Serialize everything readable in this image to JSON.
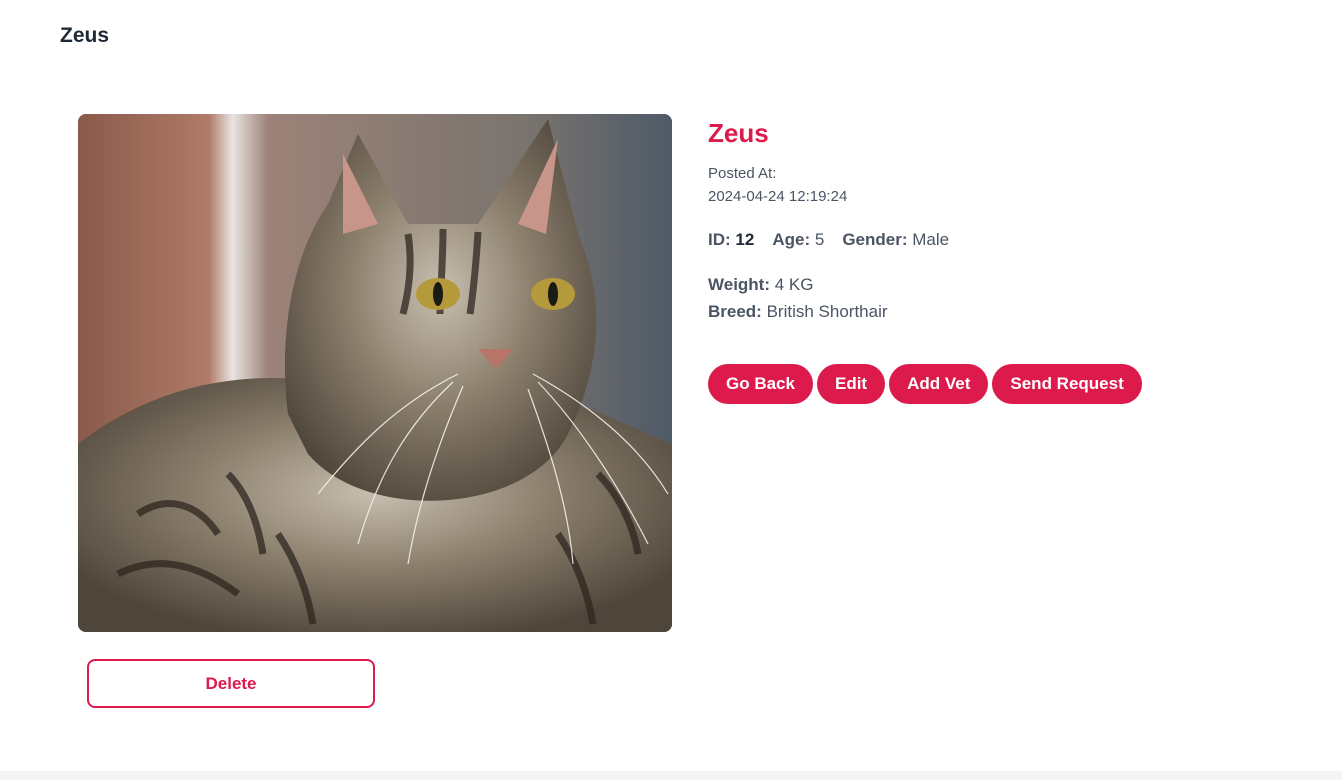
{
  "header": {
    "title": "Zeus"
  },
  "pet": {
    "name": "Zeus",
    "posted_label": "Posted At:",
    "posted_value": "2024-04-24 12:19:24",
    "id_label": "ID:",
    "id_value": "12",
    "age_label": "Age:",
    "age_value": "5",
    "gender_label": "Gender:",
    "gender_value": "Male",
    "weight_label": "Weight:",
    "weight_value": "4 KG",
    "breed_label": "Breed:",
    "breed_value": "British Shorthair"
  },
  "actions": {
    "go_back": "Go Back",
    "edit": "Edit",
    "add_vet": "Add Vet",
    "send_request": "Send Request",
    "delete": "Delete"
  },
  "colors": {
    "accent": "#dc1a4b",
    "footer": "#f3f4f6"
  }
}
